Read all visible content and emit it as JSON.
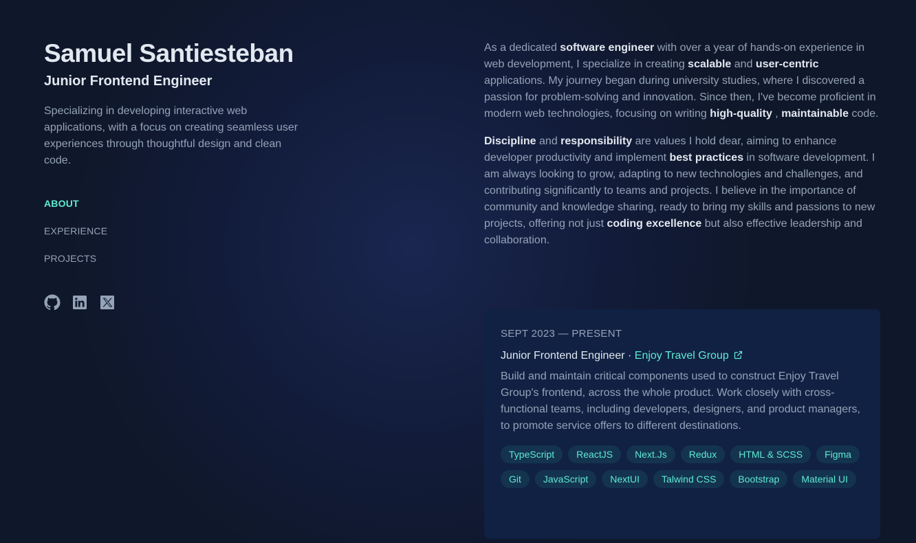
{
  "profile": {
    "name": "Samuel Santiesteban",
    "role": "Junior Frontend Engineer",
    "tagline": "Specializing in developing interactive web applications, with a focus on creating seamless user experiences through thoughtful design and clean code."
  },
  "nav": {
    "items": [
      {
        "label": "ABOUT",
        "active": true
      },
      {
        "label": "EXPERIENCE",
        "active": false
      },
      {
        "label": "PROJECTS",
        "active": false
      }
    ]
  },
  "social": {
    "icons": [
      "github-icon",
      "linkedin-icon",
      "x-icon"
    ]
  },
  "about": {
    "p1": [
      {
        "t": "As a dedicated ",
        "b": false
      },
      {
        "t": "software engineer",
        "b": true
      },
      {
        "t": " with over a year of hands-on experience in web development, I specialize in creating ",
        "b": false
      },
      {
        "t": "scalable",
        "b": true
      },
      {
        "t": " and ",
        "b": false
      },
      {
        "t": "user-centric",
        "b": true
      },
      {
        "t": " applications. My journey began during university studies, where I discovered a passion for problem-solving and innovation. Since then, I've become proficient in modern web technologies, focusing on writing ",
        "b": false
      },
      {
        "t": "high-quality",
        "b": true
      },
      {
        "t": " , ",
        "b": false
      },
      {
        "t": "maintainable",
        "b": true
      },
      {
        "t": " code.",
        "b": false
      }
    ],
    "p2": [
      {
        "t": "Discipline",
        "b": true
      },
      {
        "t": " and ",
        "b": false
      },
      {
        "t": "responsibility",
        "b": true
      },
      {
        "t": " are values I hold dear, aiming to enhance developer productivity and implement ",
        "b": false
      },
      {
        "t": "best practices",
        "b": true
      },
      {
        "t": " in software development. I am always looking to grow, adapting to new technologies and challenges, and contributing significantly to teams and projects. I believe in the importance of community and knowledge sharing, ready to bring my skills and passions to new projects, offering not just ",
        "b": false
      },
      {
        "t": "coding excellence",
        "b": true
      },
      {
        "t": " but also effective leadership and collaboration.",
        "b": false
      }
    ]
  },
  "experience": {
    "date": "SEPT 2023 — PRESENT",
    "title": "Junior Frontend Engineer",
    "separator": " · ",
    "company": "Enjoy Travel Group",
    "link_icon": "external-link-icon",
    "description": "Build and maintain critical components used to construct Enjoy Travel Group's frontend, across the whole product. Work closely with cross-functional teams, including developers, designers, and product managers, to promote service offers to different destinations.",
    "tags": [
      "TypeScript",
      "ReactJS",
      "Next.Js",
      "Redux",
      "HTML & SCSS",
      "Figma",
      "Git",
      "JavaScript",
      "NextUI",
      "Talwind CSS",
      "Bootstrap",
      "Material UI"
    ]
  },
  "colors": {
    "background": "#0f172a",
    "accent": "#5eead4",
    "heading": "#e2e8f0",
    "body_text": "#94a3b8",
    "card": "#112143"
  }
}
